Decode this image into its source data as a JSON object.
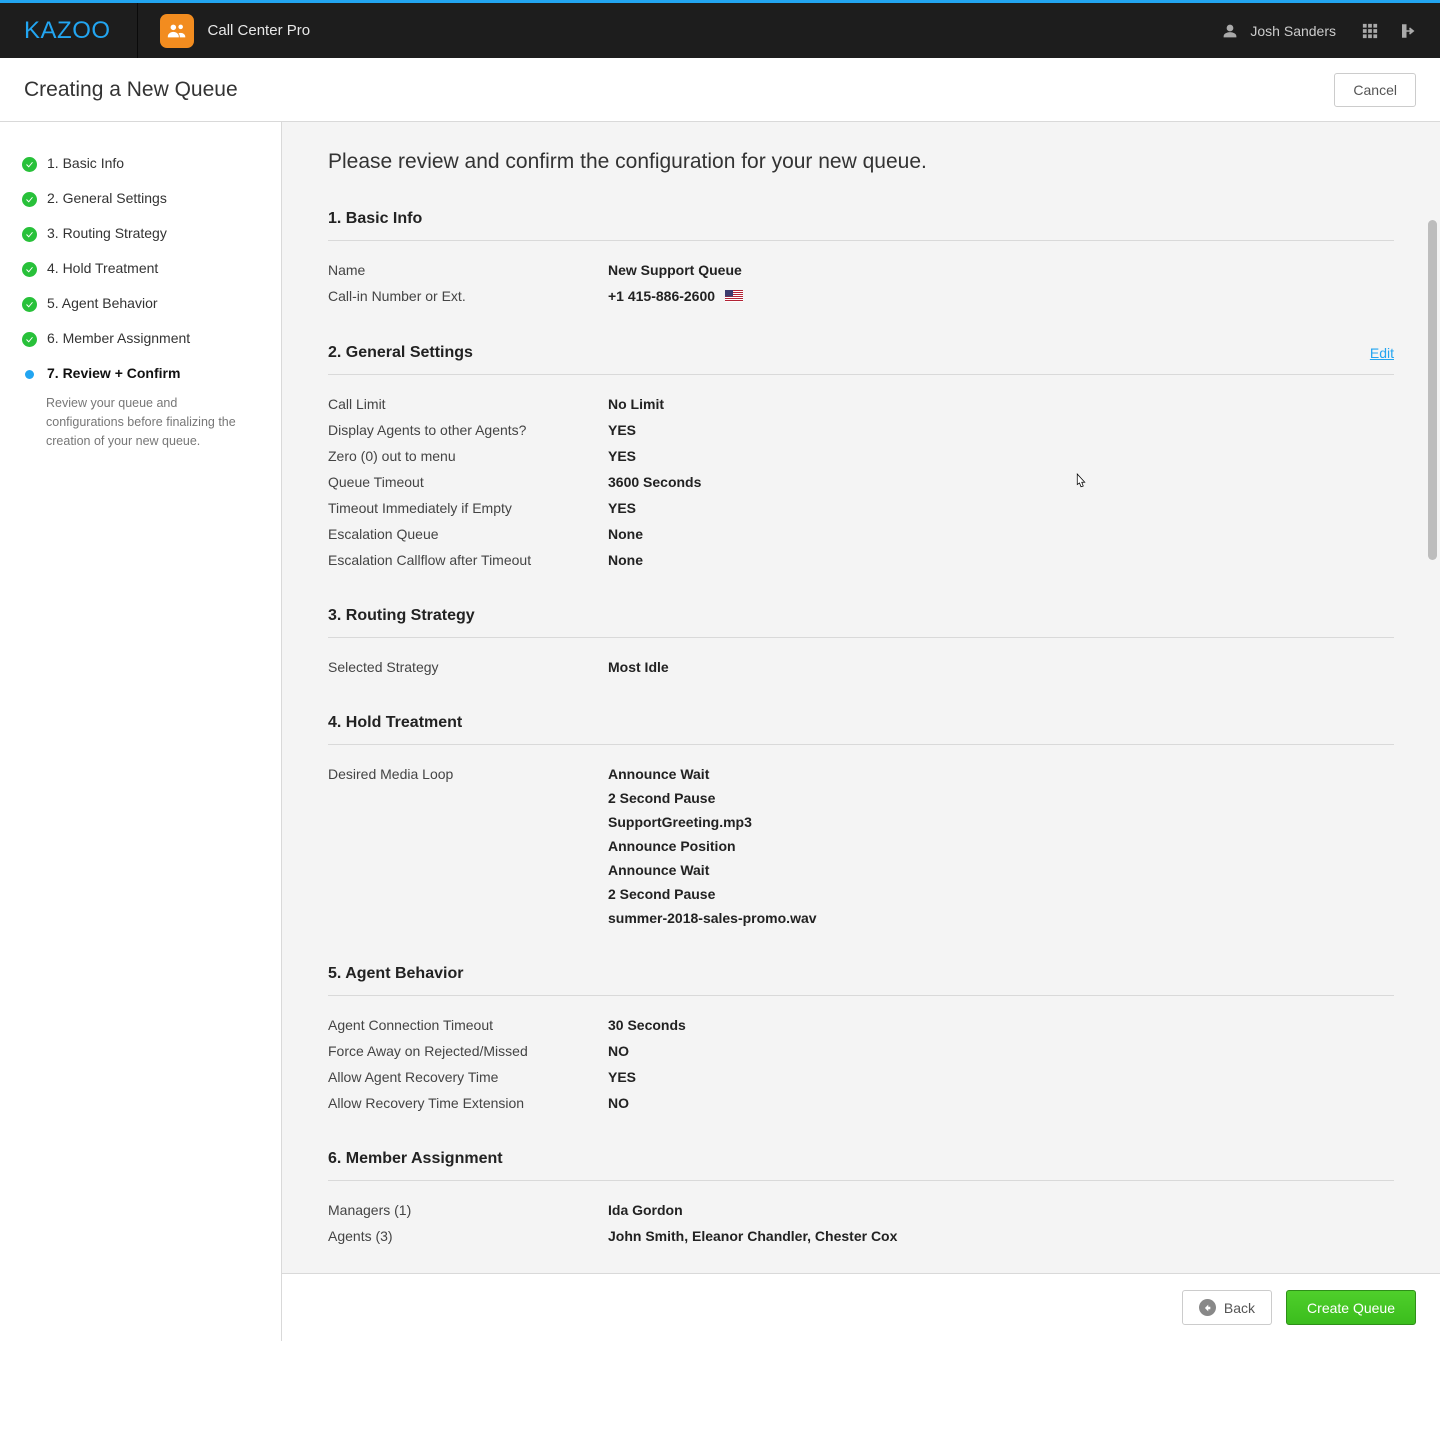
{
  "header": {
    "logo": "KAZOO",
    "app_name": "Call Center Pro",
    "user_name": "Josh Sanders"
  },
  "page": {
    "title": "Creating a New Queue",
    "cancel_label": "Cancel"
  },
  "sidebar": {
    "steps": [
      {
        "label": "1. Basic Info",
        "state": "done"
      },
      {
        "label": "2. General Settings",
        "state": "done"
      },
      {
        "label": "3. Routing Strategy",
        "state": "done"
      },
      {
        "label": "4. Hold Treatment",
        "state": "done"
      },
      {
        "label": "5. Agent Behavior",
        "state": "done"
      },
      {
        "label": "6. Member Assignment",
        "state": "done"
      },
      {
        "label": "7. Review + Confirm",
        "state": "current"
      }
    ],
    "current_description": "Review your queue and configurations before finalizing the creation of your new queue."
  },
  "review": {
    "heading": "Please review and confirm the configuration for your new queue.",
    "edit_label": "Edit",
    "sections": {
      "basic_info": {
        "title": "1. Basic Info",
        "rows": [
          {
            "label": "Name",
            "value": "New Support Queue"
          },
          {
            "label": "Call-in Number or Ext.",
            "value": "+1 415-886-2600"
          }
        ],
        "flag": "us"
      },
      "general_settings": {
        "title": "2. General Settings",
        "rows": [
          {
            "label": "Call Limit",
            "value": "No Limit"
          },
          {
            "label": "Display Agents to other Agents?",
            "value": "YES"
          },
          {
            "label": "Zero (0) out to menu",
            "value": "YES"
          },
          {
            "label": "Queue Timeout",
            "value": "3600 Seconds"
          },
          {
            "label": "Timeout Immediately if Empty",
            "value": "YES"
          },
          {
            "label": "Escalation Queue",
            "value": "None"
          },
          {
            "label": "Escalation Callflow after Timeout",
            "value": "None"
          }
        ]
      },
      "routing_strategy": {
        "title": "3. Routing Strategy",
        "rows": [
          {
            "label": "Selected Strategy",
            "value": "Most Idle"
          }
        ]
      },
      "hold_treatment": {
        "title": "4. Hold Treatment",
        "label": "Desired Media Loop",
        "items": [
          "Announce Wait",
          "2 Second Pause",
          "SupportGreeting.mp3",
          "Announce Position",
          "Announce Wait",
          "2 Second Pause",
          "summer-2018-sales-promo.wav"
        ]
      },
      "agent_behavior": {
        "title": "5. Agent Behavior",
        "rows": [
          {
            "label": "Agent Connection Timeout",
            "value": "30 Seconds"
          },
          {
            "label": "Force Away on Rejected/Missed",
            "value": "NO"
          },
          {
            "label": "Allow Agent Recovery Time",
            "value": "YES"
          },
          {
            "label": "Allow Recovery Time Extension",
            "value": "NO"
          }
        ]
      },
      "member_assignment": {
        "title": "6. Member Assignment",
        "rows": [
          {
            "label": "Managers (1)",
            "value": "Ida Gordon"
          },
          {
            "label": "Agents (3)",
            "value": "John Smith, Eleanor Chandler, Chester Cox"
          }
        ]
      }
    }
  },
  "footer": {
    "back_label": "Back",
    "create_label": "Create Queue"
  }
}
